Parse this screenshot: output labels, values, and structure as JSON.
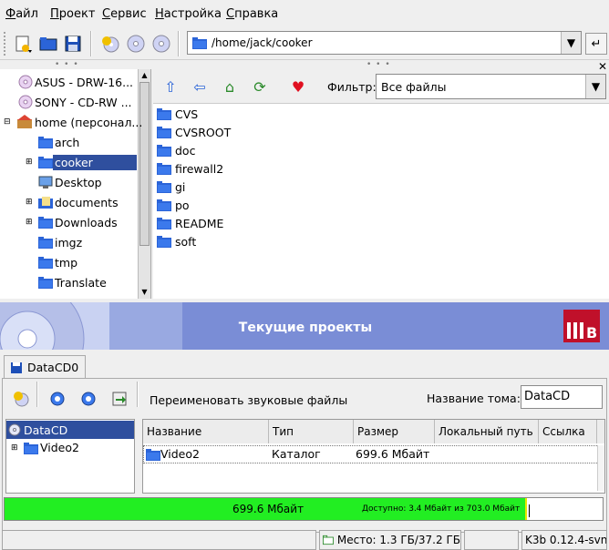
{
  "menu": {
    "file": {
      "u": "Ф",
      "rest": "айл"
    },
    "project": {
      "u": "П",
      "rest": "роект"
    },
    "service": {
      "u": "С",
      "rest": "ервис"
    },
    "settings": {
      "u": "Н",
      "rest": "астройка"
    },
    "help": {
      "u": "С",
      "rest": "правка"
    }
  },
  "location": {
    "path": "/home/jack/cooker"
  },
  "tree": {
    "items": [
      {
        "label": "ASUS - DRW-16...",
        "icon": "cdrom-icon"
      },
      {
        "label": "SONY - CD-RW ...",
        "icon": "cdrom-icon"
      },
      {
        "label": "home (персонал...",
        "icon": "home-folder-icon"
      },
      {
        "label": "arch",
        "icon": "folder-icon"
      },
      {
        "label": "cooker",
        "icon": "folder-icon",
        "selected": true
      },
      {
        "label": "Desktop",
        "icon": "desktop-icon"
      },
      {
        "label": "documents",
        "icon": "documents-folder-icon"
      },
      {
        "label": "Downloads",
        "icon": "folder-icon"
      },
      {
        "label": "imgz",
        "icon": "folder-icon"
      },
      {
        "label": "tmp",
        "icon": "folder-icon"
      },
      {
        "label": "Translate",
        "icon": "folder-icon"
      }
    ]
  },
  "filter": {
    "label": "Фильтр:",
    "value": "Все файлы"
  },
  "files": [
    "CVS",
    "CVSROOT",
    "doc",
    "firewall2",
    "gi",
    "po",
    "README",
    "soft"
  ],
  "banner": {
    "title": "Текущие проекты"
  },
  "project": {
    "tab_label": "DataCD0",
    "rename_label": "Переименовать звуковые файлы",
    "volume_label": "Название тома:",
    "volume_value": "DataCD",
    "tree": {
      "root": "DataCD",
      "child": "Video2"
    },
    "columns": [
      "Название",
      "Тип",
      "Размер",
      "Локальный путь",
      "Ссылка"
    ],
    "rows": [
      {
        "name": "Video2",
        "type": "Каталог",
        "size": "699.6 Мбайт",
        "path": "",
        "link": ""
      }
    ]
  },
  "progress": {
    "used_label": "699.6 Мбайт",
    "available_label": "Доступно: 3.4 Мбайт из 703.0 Мбайт",
    "used_fraction": 0.9952
  },
  "status": {
    "space": "Место: 1.3 ГБ/37.2 ГБ",
    "version": "K3b 0.12.4-svn"
  },
  "colors": {
    "selection": "#2f4f9e",
    "banner": "#7a8dd6",
    "progress": "#22ee22",
    "folder": "#2b64d8"
  }
}
